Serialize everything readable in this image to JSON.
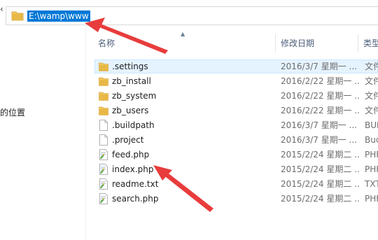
{
  "address_bar": {
    "path": "E:\\wamp\\www",
    "folder_icon": "folder-icon"
  },
  "nav_pane": {
    "partial_item": "的位置"
  },
  "columns": {
    "name": "名称",
    "modified": "修改日期",
    "type": "类型"
  },
  "files": [
    {
      "name": ".settings",
      "modified": "2016/3/7 星期一 ...",
      "type": "文件",
      "icon": "folder-icon"
    },
    {
      "name": "zb_install",
      "modified": "2016/2/22 星期一 ...",
      "type": "文件",
      "icon": "folder-icon"
    },
    {
      "name": "zb_system",
      "modified": "2016/2/22 星期一 ...",
      "type": "文件",
      "icon": "folder-icon"
    },
    {
      "name": "zb_users",
      "modified": "2016/2/22 星期一 ...",
      "type": "文件",
      "icon": "folder-icon"
    },
    {
      "name": ".buildpath",
      "modified": "2016/3/7 星期一 ...",
      "type": "BUI",
      "icon": "blank-file-icon"
    },
    {
      "name": ".project",
      "modified": "2016/3/7 星期一 ...",
      "type": "Buc",
      "icon": "blank-file-icon"
    },
    {
      "name": "feed.php",
      "modified": "2015/2/24 星期二 ...",
      "type": "PHF",
      "icon": "script-file-icon"
    },
    {
      "name": "index.php",
      "modified": "2015/2/24 星期二 ...",
      "type": "PHF",
      "icon": "script-file-icon"
    },
    {
      "name": "readme.txt",
      "modified": "2015/2/24 星期二 ...",
      "type": "TXT",
      "icon": "script-file-icon"
    },
    {
      "name": "search.php",
      "modified": "2015/2/24 星期二 ...",
      "type": "PHF",
      "icon": "script-file-icon"
    }
  ],
  "selected_index": 0,
  "colors": {
    "accent": "#0078d7",
    "selection_bg": "#e5f3ff",
    "selection_border": "#cce8ff",
    "annotation_arrow": "#e83c3c",
    "folder": "#e8b847"
  }
}
